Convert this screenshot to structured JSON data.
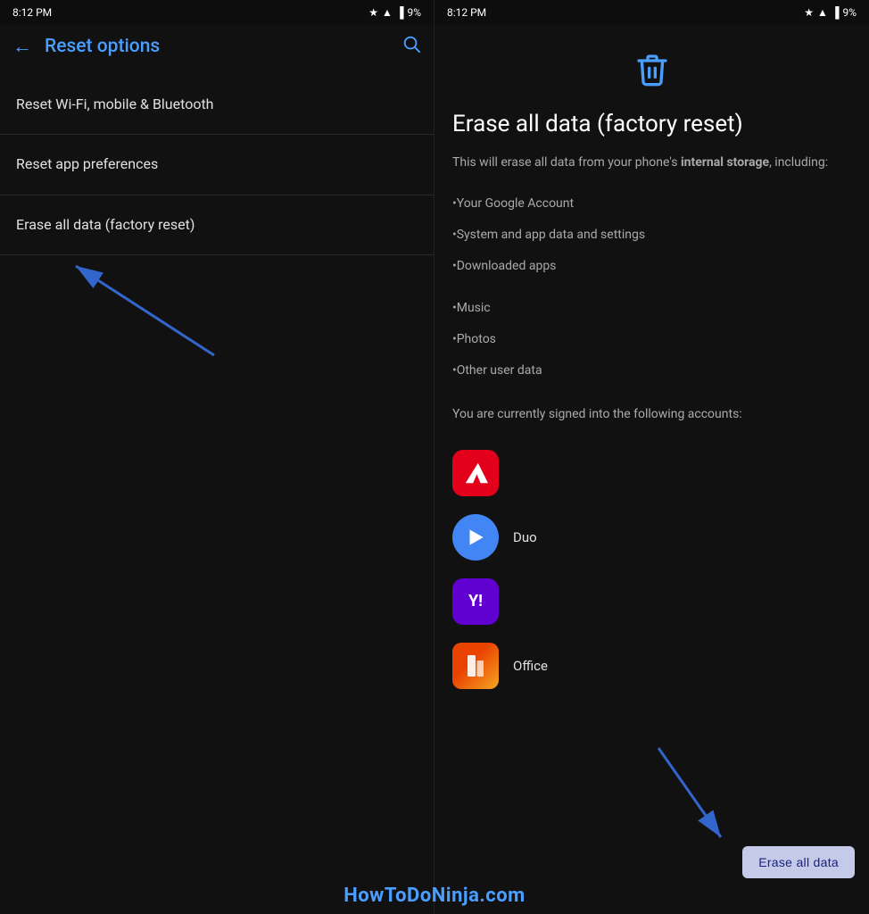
{
  "statusBar": {
    "time": "8:12 PM",
    "battery": "9%"
  },
  "leftPanel": {
    "title": "Reset options",
    "menuItems": [
      {
        "id": "wifi-reset",
        "label": "Reset Wi-Fi, mobile & Bluetooth"
      },
      {
        "id": "app-prefs",
        "label": "Reset app preferences"
      },
      {
        "id": "factory-reset",
        "label": "Erase all data (factory reset)"
      }
    ]
  },
  "rightPanel": {
    "title": "Erase all data (factory reset)",
    "description_prefix": "This will erase all data from your phone's ",
    "description_bold": "internal storage",
    "description_suffix": ", including:",
    "bulletItems": [
      "•Your Google Account",
      "•System and app data and settings",
      "•Downloaded apps",
      "•Music",
      "•Photos",
      "•Other user data"
    ],
    "accountsLabel": "You are currently signed into the following accounts:",
    "accounts": [
      {
        "id": "adobe",
        "name": "",
        "icon": "A",
        "style": "adobe"
      },
      {
        "id": "duo",
        "name": "Duo",
        "icon": "▶",
        "style": "duo"
      },
      {
        "id": "yahoo",
        "name": "",
        "icon": "Y!",
        "style": "yahoo"
      },
      {
        "id": "office",
        "name": "Office",
        "icon": "W",
        "style": "office"
      }
    ],
    "eraseButtonLabel": "Erase all data"
  },
  "watermark": "HowToDoNinja.com"
}
